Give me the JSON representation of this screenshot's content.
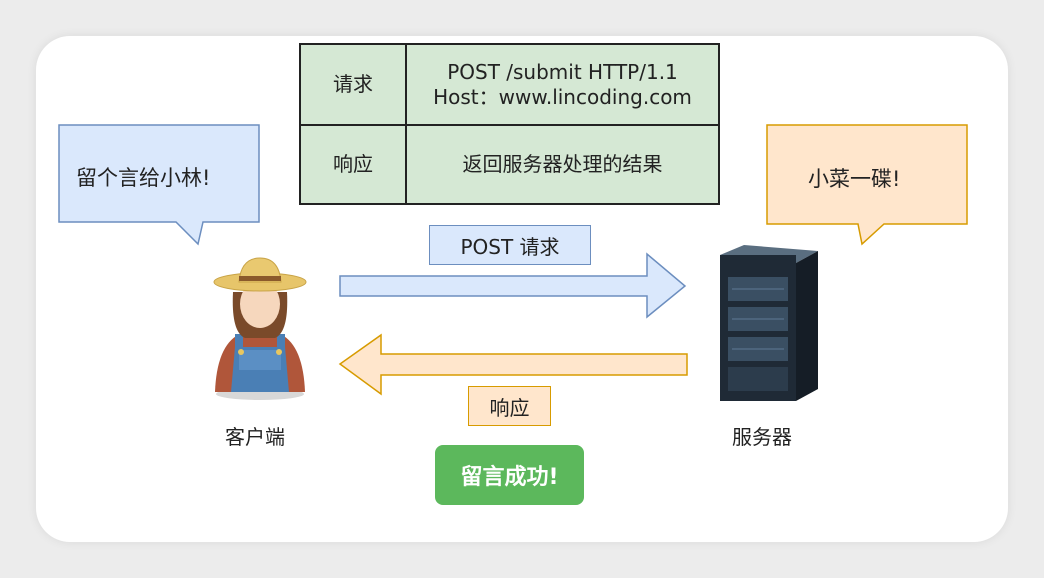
{
  "table": {
    "request_header": "请求",
    "request_line1": "POST /submit HTTP/1.1",
    "request_line2": "Host：www.lincoding.com",
    "response_header": "响应",
    "response_body": "返回服务器处理的结果"
  },
  "client": {
    "bubble": "留个言给小林!",
    "caption": "客户端"
  },
  "server": {
    "bubble": "小菜一碟!",
    "caption": "服务器"
  },
  "arrows": {
    "request_label": "POST  请求",
    "response_label": "响应"
  },
  "success_button": "留言成功!",
  "colors": {
    "table_fill": "#d5e8d4",
    "request_fill": "#dae8fc",
    "request_stroke": "#6c8ebf",
    "response_fill": "#ffe6cc",
    "response_stroke": "#d79b00",
    "success": "#5cb85c"
  }
}
